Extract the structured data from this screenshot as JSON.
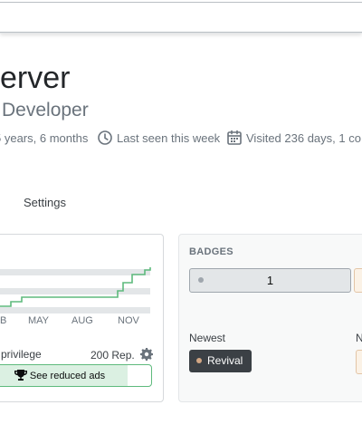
{
  "header": {
    "search_placeholder": ""
  },
  "profile": {
    "name": "erver",
    "role": "Developer",
    "member_for": "5 years, 6 months",
    "last_seen": "Last seen this week",
    "visited": "Visited 236 days, 1 co"
  },
  "tabs": {
    "settings": "Settings"
  },
  "reputation_chart": {
    "months": [
      "B",
      "MAY",
      "AUG",
      "NOV"
    ],
    "line_color": "#5eba7d"
  },
  "privilege": {
    "label": "privilege",
    "rep": "200 Rep.",
    "button": "See reduced ads",
    "progress": 0.85
  },
  "badges": {
    "title": "BADGES",
    "bronze_count": "1",
    "newest_label": "Newest",
    "newest_label_2": "N",
    "newest_badge": "Revival"
  },
  "colors": {
    "accent": "#5eba7d",
    "badge_bronze": "#d1a684",
    "text_muted": "#6a737c"
  }
}
